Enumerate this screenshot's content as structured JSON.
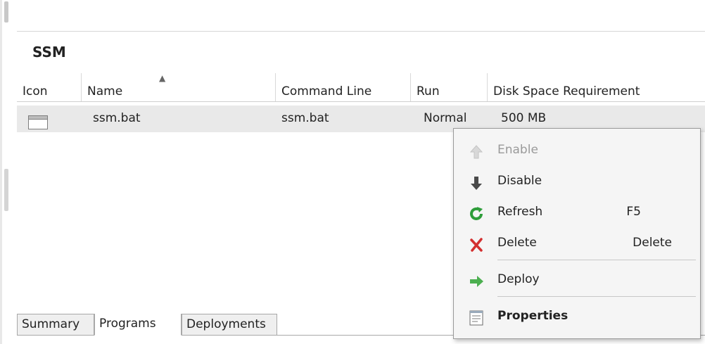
{
  "panel": {
    "title": "SSM"
  },
  "table": {
    "columns": [
      "Icon",
      "Name",
      "Command Line",
      "Run",
      "Disk Space Requirement"
    ],
    "rows": [
      {
        "name": "ssm.bat",
        "command_line": "ssm.bat",
        "run": "Normal",
        "disk_space": "500 MB"
      }
    ]
  },
  "tabs": [
    "Summary",
    "Programs",
    "Deployments"
  ],
  "active_tab": "Programs",
  "context_menu": {
    "items": [
      {
        "label": "Enable",
        "icon": "up-arrow-icon",
        "enabled": false
      },
      {
        "label": "Disable",
        "icon": "down-arrow-icon",
        "enabled": true
      },
      {
        "label": "Refresh",
        "shortcut": "F5",
        "icon": "refresh-icon",
        "enabled": true
      },
      {
        "label": "Delete",
        "shortcut": "Delete",
        "icon": "delete-x-icon",
        "enabled": true
      },
      {
        "label": "Deploy",
        "icon": "deploy-arrow-icon",
        "enabled": true
      },
      {
        "label": "Properties",
        "icon": "properties-icon",
        "enabled": true
      }
    ]
  },
  "colors": {
    "refresh_green": "#2e9d3a",
    "delete_red": "#d32f2f",
    "deploy_green": "#4caf50"
  }
}
